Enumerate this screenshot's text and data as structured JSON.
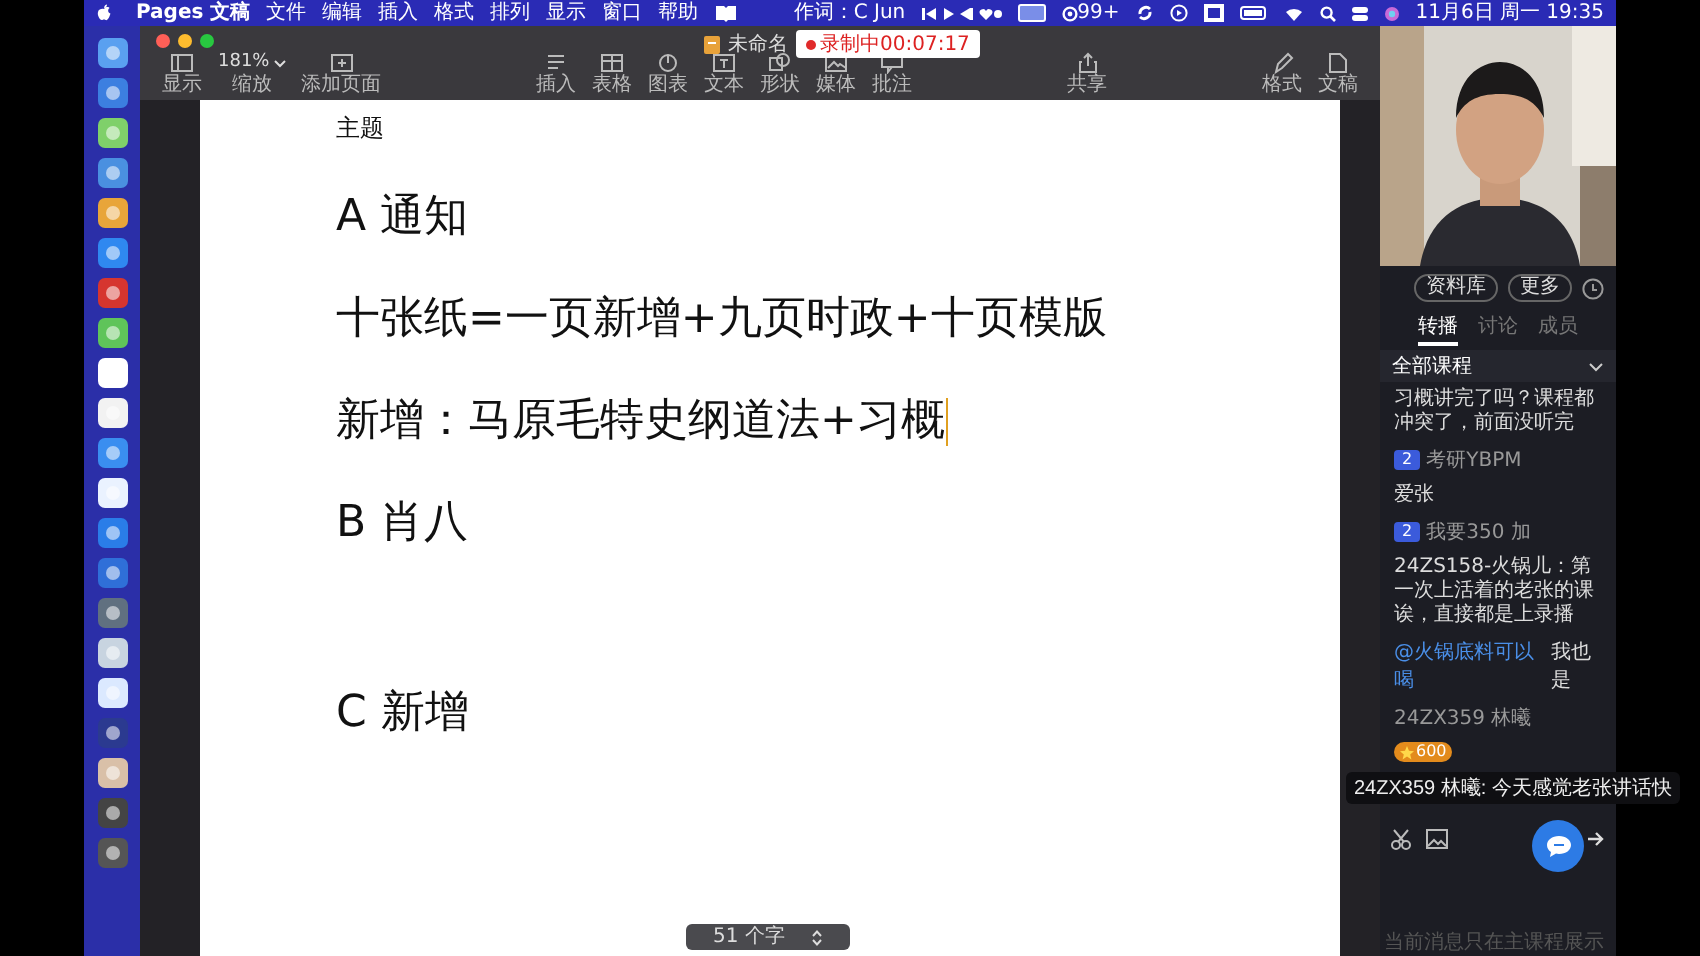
{
  "menu_bar": {
    "app_name": "Pages 文稿",
    "menus": [
      "文件",
      "编辑",
      "插入",
      "格式",
      "排列",
      "显示",
      "窗口",
      "帮助"
    ],
    "now_playing": "作词：C Jun",
    "notification_count": "99+",
    "clock": "11月6日 周一 19:35"
  },
  "window": {
    "title": "未命名",
    "recording": "录制中00:07:17"
  },
  "toolbar": {
    "left": [
      {
        "kind": "sidebar",
        "label": "显示"
      },
      {
        "kind": "zoom",
        "value": "181%",
        "label": "缩放"
      },
      {
        "kind": "addpage",
        "label": "添加页面"
      }
    ],
    "middle": [
      {
        "kind": "insert",
        "label": "插入"
      },
      {
        "kind": "table",
        "label": "表格"
      },
      {
        "kind": "chart",
        "label": "图表"
      },
      {
        "kind": "text",
        "label": "文本"
      },
      {
        "kind": "shape",
        "label": "形状"
      },
      {
        "kind": "media",
        "label": "媒体"
      },
      {
        "kind": "comment",
        "label": "批注"
      }
    ],
    "share": {
      "kind": "share",
      "label": "共享"
    },
    "right": [
      {
        "kind": "format",
        "label": "格式"
      },
      {
        "kind": "document",
        "label": "文稿"
      }
    ]
  },
  "document": {
    "heading": "主题",
    "lines": [
      {
        "kind": "text",
        "text": "A 通知",
        "cursor": false
      },
      {
        "kind": "text",
        "text": "十张纸=一页新增+九页时政+十页模版",
        "cursor": false
      },
      {
        "kind": "text",
        "text": "新增：马原毛特史纲道法+习概",
        "cursor": true
      },
      {
        "kind": "text",
        "text": "B 肖八",
        "cursor": false
      },
      {
        "kind": "blank"
      },
      {
        "kind": "text",
        "text": "C 新增",
        "cursor": false
      }
    ],
    "word_count": "51 个字"
  },
  "chat": {
    "buttons": [
      "资料库",
      "更多"
    ],
    "tabs": [
      {
        "label": "转播",
        "selected": true
      },
      {
        "label": "讨论",
        "selected": false
      },
      {
        "label": "成员",
        "selected": false
      }
    ],
    "section": "全部课程",
    "messages": [
      {
        "kind": "text",
        "text": "习概讲完了吗？课程都冲突了，前面没听完"
      },
      {
        "kind": "user",
        "rank": "2",
        "name": "考研YBPM",
        "text": "爱张"
      },
      {
        "kind": "user",
        "rank": "2",
        "name": "我要350 加",
        "text": "24ZS158-火锅儿：第一次上活着的老张的课诶，直接都是上录播"
      },
      {
        "kind": "reply",
        "mention": "@火锅底料可以喝",
        "text": "我也是"
      },
      {
        "kind": "badge",
        "name": "24ZX359 林曦",
        "badge": "600"
      }
    ],
    "toast": "24ZX359 林曦: 今天感觉老张讲话快",
    "footer": "当前消息只在主课程展示"
  }
}
